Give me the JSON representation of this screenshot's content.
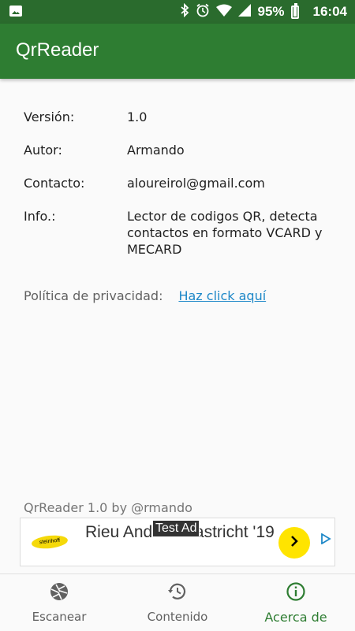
{
  "status_bar": {
    "battery": "95%",
    "time": "16:04",
    "icons": [
      "image-icon",
      "bluetooth-icon",
      "alarm-icon",
      "wifi-icon",
      "signal-icon",
      "battery-icon"
    ]
  },
  "app_bar": {
    "title": "QrReader"
  },
  "info": {
    "version_label": "Versión:",
    "version_value": "1.0",
    "author_label": "Autor:",
    "author_value": "Armando",
    "contact_label": "Contacto:",
    "contact_value": "aloureirol@gmail.com",
    "info_label": "Info.:",
    "info_value": "Lector de codigos QR, detecta contactos en formato VCARD y MECARD"
  },
  "privacy": {
    "label": "Política de privacidad:",
    "link": "Haz click aquí"
  },
  "footer": {
    "text": "QrReader 1.0 by @rmando"
  },
  "ad": {
    "headline": "Rieu André Maastricht '19",
    "badge": "Test Ad",
    "logo_text": "steinhoff"
  },
  "bottom_nav": {
    "tabs": [
      {
        "label": "Escanear",
        "icon": "camera-shutter-icon"
      },
      {
        "label": "Contenido",
        "icon": "history-icon"
      },
      {
        "label": "Acerca de",
        "icon": "info-icon"
      }
    ],
    "active_index": 2
  },
  "colors": {
    "primary": "#2e7d32",
    "status_bar": "#2a6b2d",
    "link": "#1e88c8",
    "ad_cta": "#ffe400"
  }
}
